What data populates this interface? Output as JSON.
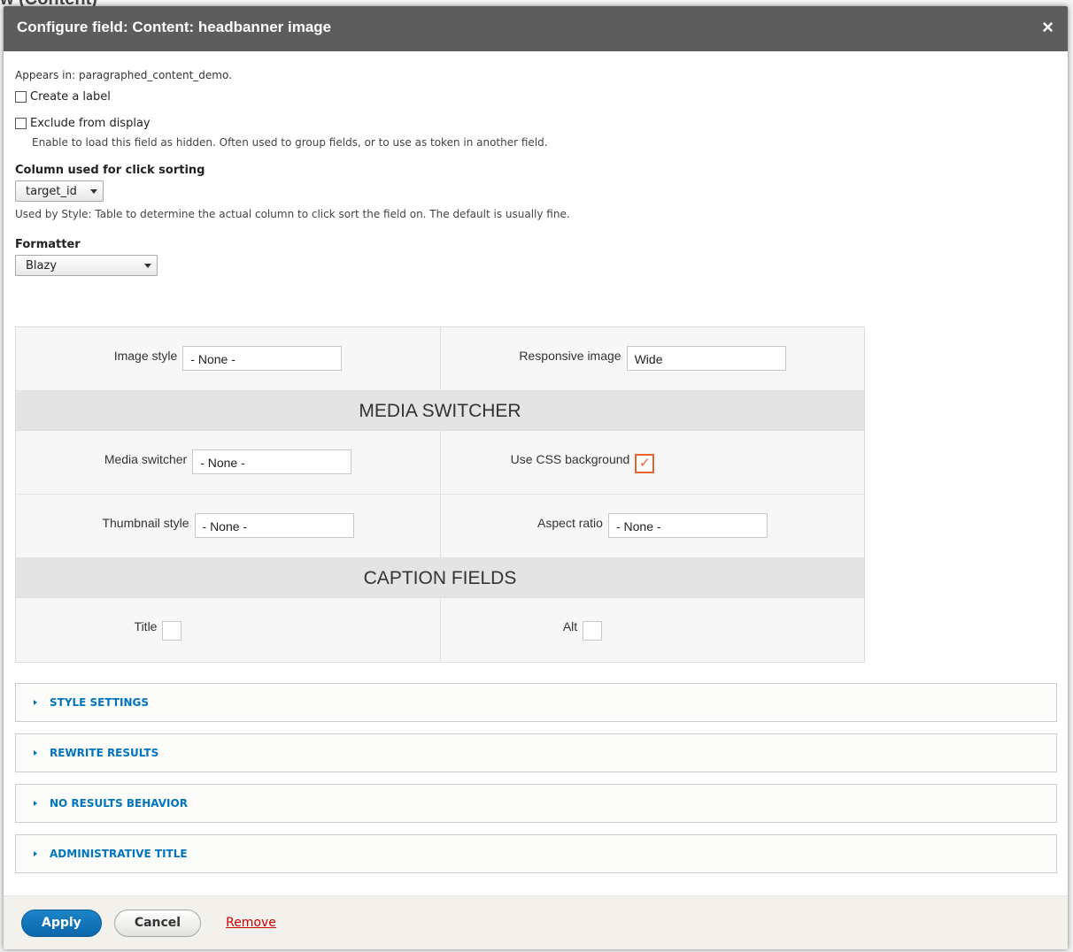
{
  "background": {
    "page_title_fragment": "w (Content)"
  },
  "dialog": {
    "title": "Configure field: Content: headbanner image",
    "close_glyph": "×"
  },
  "form": {
    "appears_in": "Appears in: paragraphed_content_demo.",
    "create_label": {
      "label": "Create a label",
      "checked": false
    },
    "exclude_display": {
      "label": "Exclude from display",
      "checked": false,
      "description": "Enable to load this field as hidden. Often used to group fields, or to use as token in another field."
    },
    "click_sort": {
      "label": "Column used for click sorting",
      "value": "target_id",
      "help": "Used by Style: Table to determine the actual column to click sort the field on. The default is usually fine."
    },
    "formatter": {
      "label": "Formatter",
      "value": "Blazy"
    }
  },
  "blazy": {
    "image_style": {
      "label": "Image style",
      "value": "- None -"
    },
    "responsive_image": {
      "label": "Responsive image",
      "value": "Wide"
    },
    "media_switcher_heading": "MEDIA SWITCHER",
    "media_switcher": {
      "label": "Media switcher",
      "value": "- None -"
    },
    "use_css_bg": {
      "label": "Use CSS background",
      "checked": true,
      "glyph": "✓"
    },
    "thumbnail_style": {
      "label": "Thumbnail style",
      "value": "- None -"
    },
    "aspect_ratio": {
      "label": "Aspect ratio",
      "value": "- None -"
    },
    "caption_heading": "CAPTION FIELDS",
    "caption_title": {
      "label": "Title",
      "checked": false
    },
    "caption_alt": {
      "label": "Alt",
      "checked": false
    }
  },
  "details": [
    {
      "label": "STYLE SETTINGS"
    },
    {
      "label": "REWRITE RESULTS"
    },
    {
      "label": "NO RESULTS BEHAVIOR"
    },
    {
      "label": "ADMINISTRATIVE TITLE"
    }
  ],
  "footer": {
    "apply": "Apply",
    "cancel": "Cancel",
    "remove": "Remove"
  },
  "colors": {
    "primary": "#0a67aa",
    "link": "#0074bd",
    "accent_check": "#e8622c",
    "titlebar": "#5d5d5d"
  }
}
